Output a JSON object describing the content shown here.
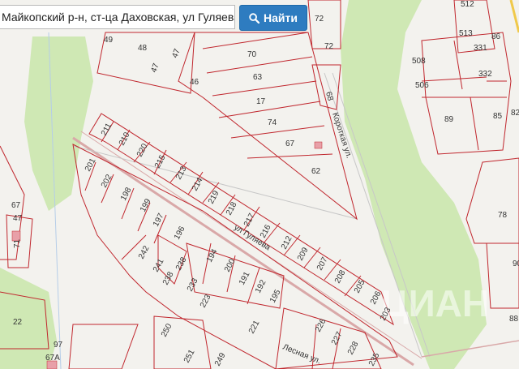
{
  "search": {
    "value": "Майкопский р-н, ст-ца Даховская, ул Гуляева",
    "button_label": "Найти"
  },
  "map": {
    "streets": [
      "ул Гуляева",
      "Короткая ул.",
      "Лесная ул."
    ],
    "parcels": [
      "512",
      "513",
      "86",
      "72",
      "72",
      "49",
      "48",
      "47",
      "47",
      "46",
      "70",
      "63",
      "17",
      "74",
      "67",
      "68",
      "62",
      "508",
      "331",
      "506",
      "332",
      "89",
      "85",
      "82",
      "211",
      "210",
      "220",
      "215",
      "213",
      "214",
      "219",
      "218",
      "217",
      "216",
      "212",
      "209",
      "207",
      "208",
      "205",
      "206",
      "203",
      "201",
      "202",
      "198",
      "199",
      "197",
      "196",
      "242",
      "241",
      "238",
      "238",
      "233",
      "223",
      "194",
      "200",
      "191",
      "192",
      "195",
      "250",
      "221",
      "226",
      "227",
      "228",
      "235",
      "251",
      "249",
      "97",
      "67A",
      "22",
      "71",
      "47",
      "67",
      "78",
      "90",
      "88"
    ],
    "watermark": "ЦИАН",
    "colors": {
      "forest": "#cfe8b4",
      "background": "#f3f2ee",
      "parcel_border": "#c0262d",
      "road": "#d9a8a8"
    }
  }
}
